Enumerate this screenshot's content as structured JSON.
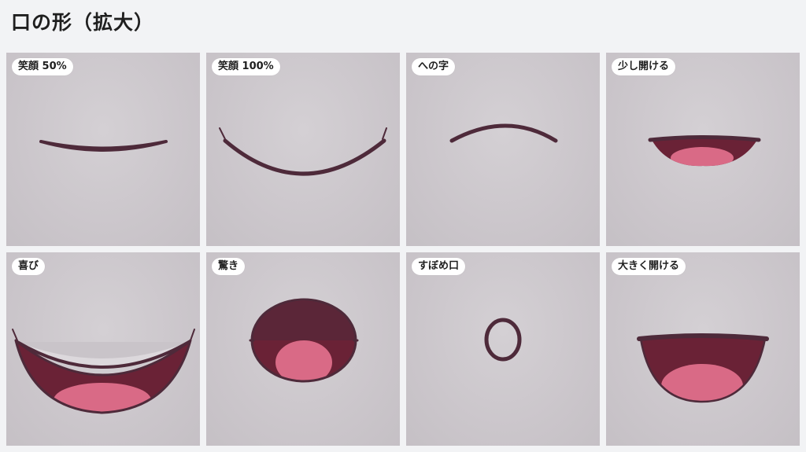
{
  "page": {
    "title": "口の形（拡大）"
  },
  "tiles": [
    {
      "label": "笑顔 50%",
      "shape": "smile-half-icon"
    },
    {
      "label": "笑顔 100%",
      "shape": "smile-full-icon"
    },
    {
      "label": "への字",
      "shape": "frown-icon"
    },
    {
      "label": "少し開ける",
      "shape": "slightly-open-mouth-icon"
    },
    {
      "label": "喜び",
      "shape": "joy-mouth-icon"
    },
    {
      "label": "驚き",
      "shape": "surprised-mouth-icon"
    },
    {
      "label": "すぼめ口",
      "shape": "pursed-mouth-icon"
    },
    {
      "label": "大きく開ける",
      "shape": "wide-open-mouth-icon"
    }
  ],
  "colors": {
    "page_background": "#f2f3f5",
    "tile_background": "#ccc7cc",
    "lip_line": "#4e2a3a",
    "mouth_interior": "#6a2236",
    "tongue": "#d96a86",
    "label_background": "#ffffff"
  }
}
